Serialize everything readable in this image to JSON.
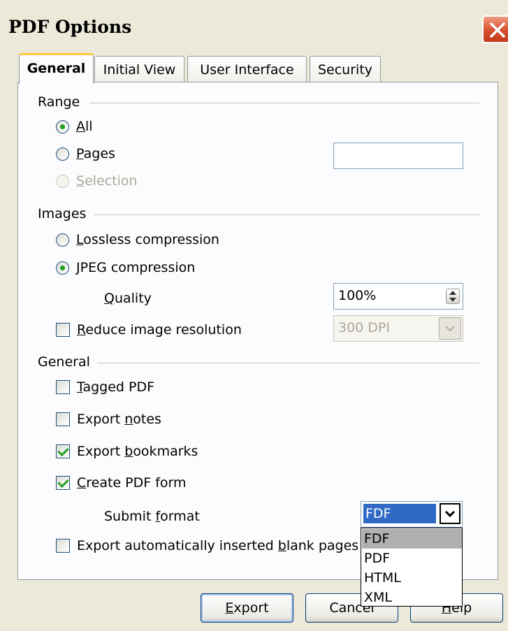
{
  "window": {
    "title": "PDF Options"
  },
  "tabs": [
    {
      "label": "General",
      "active": true
    },
    {
      "label": "Initial View"
    },
    {
      "label": "User Interface"
    },
    {
      "label": "Security"
    }
  ],
  "range": {
    "heading": "Range",
    "all": {
      "pre": "",
      "key": "A",
      "post": "ll"
    },
    "pages": {
      "pre": "",
      "key": "P",
      "post": "ages"
    },
    "selection": {
      "pre": "",
      "key": "S",
      "post": "election"
    },
    "pages_value": ""
  },
  "images": {
    "heading": "Images",
    "lossless": {
      "pre": "",
      "key": "L",
      "post": "ossless compression"
    },
    "jpeg": {
      "pre": "",
      "key": "J",
      "post": "PEG compression"
    },
    "quality": {
      "pre": "",
      "key": "Q",
      "post": "uality"
    },
    "quality_value": "100%",
    "reduce": {
      "pre": "",
      "key": "R",
      "post": "educe image resolution"
    },
    "resolution_value": "300 DPI"
  },
  "general": {
    "heading": "General",
    "tagged": {
      "pre": "",
      "key": "T",
      "post": "agged PDF"
    },
    "notes": {
      "pre": "Export ",
      "key": "n",
      "post": "otes"
    },
    "bookmarks": {
      "pre": "Export ",
      "key": "b",
      "post": "ookmarks"
    },
    "form": {
      "pre": "",
      "key": "C",
      "post": "reate PDF form"
    },
    "submit": {
      "pre": "Submit ",
      "key": "f",
      "post": "ormat"
    },
    "submit_value": "FDF",
    "submit_options": [
      "FDF",
      "PDF",
      "HTML",
      "XML"
    ],
    "blank": {
      "pre": "Export automatically inserted ",
      "key": "b",
      "post": "lank pages"
    }
  },
  "buttons": {
    "export": {
      "pre": "",
      "key": "E",
      "post": "xport"
    },
    "cancel": "Cancel",
    "help": {
      "pre": "",
      "key": "H",
      "post": "elp"
    }
  },
  "colors": {
    "accent": "#316ac5",
    "check": "#21a121",
    "tab_highlight": "#ffc83c",
    "close": "#d6502f"
  }
}
